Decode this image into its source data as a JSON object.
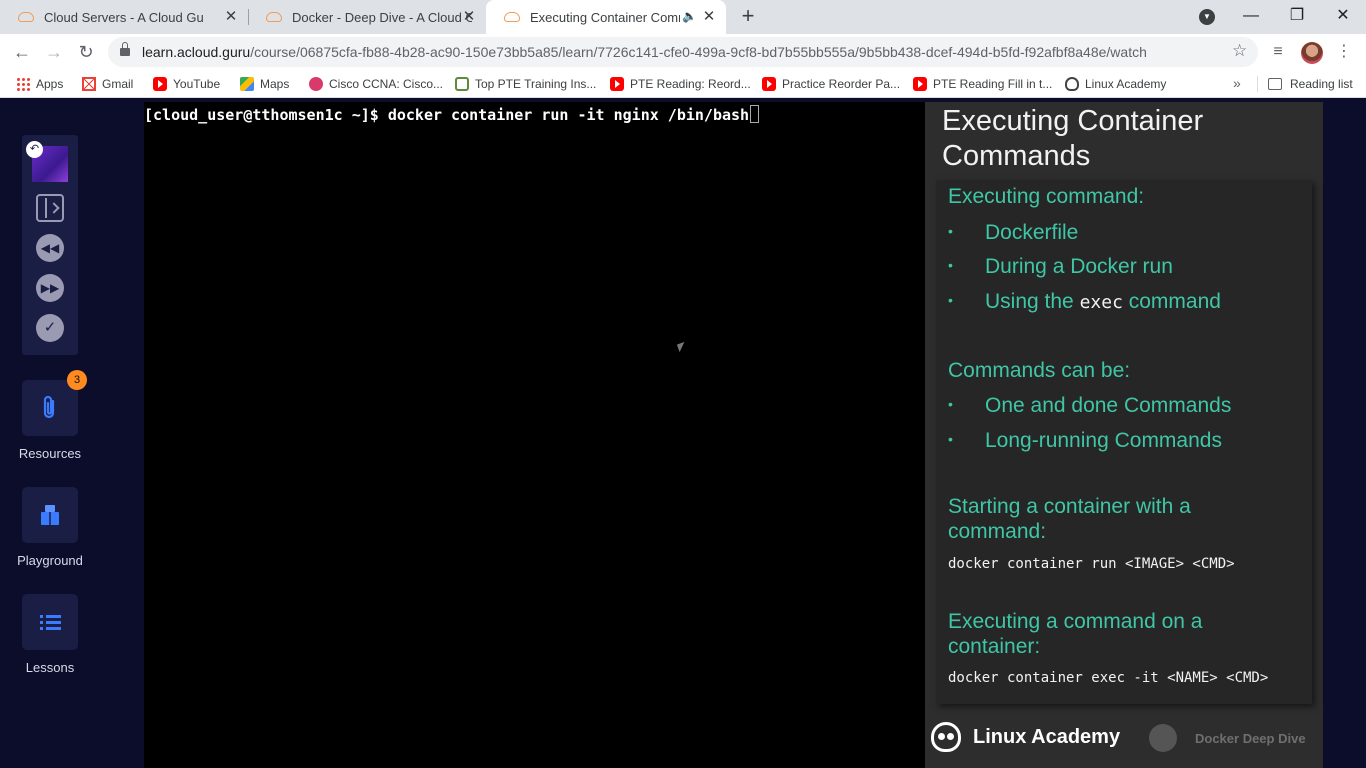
{
  "browser": {
    "tabs": [
      {
        "title": "Cloud Servers - A Cloud Guru",
        "active": false
      },
      {
        "title": "Docker - Deep Dive - A Cloud Gu",
        "active": false
      },
      {
        "title": "Executing Container Comma",
        "active": true
      }
    ],
    "new_tab": "+",
    "url_host": "learn.acloud.guru",
    "url_path": "/course/06875cfa-fb88-4b28-ac90-150e73bb5a85/learn/7726c141-cfe0-499a-9cf8-bd7b55bb555a/9b5bb438-dcef-494d-b5fd-f92afbf8a48e/watch",
    "bookmarks": [
      {
        "label": "Apps",
        "icon": "apps-grid-icon"
      },
      {
        "label": "Gmail",
        "icon": "gmail-icon"
      },
      {
        "label": "YouTube",
        "icon": "youtube-icon"
      },
      {
        "label": "Maps",
        "icon": "maps-icon"
      },
      {
        "label": "Cisco CCNA: Cisco...",
        "icon": "cisco-icon"
      },
      {
        "label": "Top PTE Training Ins...",
        "icon": "pte-icon"
      },
      {
        "label": "PTE Reading: Reord...",
        "icon": "youtube-icon"
      },
      {
        "label": "Practice Reorder Pa...",
        "icon": "youtube-icon"
      },
      {
        "label": "PTE Reading Fill in t...",
        "icon": "youtube-icon"
      },
      {
        "label": "Linux Academy",
        "icon": "linux-academy-icon"
      }
    ],
    "reading_list": "Reading list"
  },
  "sidebar": {
    "resources_label": "Resources",
    "resources_badge": "3",
    "playground_label": "Playground",
    "lessons_label": "Lessons"
  },
  "terminal": {
    "prompt": "[cloud_user@tthomsen1c ~]$ ",
    "command": "docker container run -it nginx /bin/bash"
  },
  "slide": {
    "title": "Executing Container Commands",
    "section1": "Executing command:",
    "bullet1": "Dockerfile",
    "bullet2": "During a Docker run",
    "bullet3_pre": "Using the ",
    "bullet3_code": "exec",
    "bullet3_post": " command",
    "section2": "Commands can be:",
    "bullet4": "One and done Commands",
    "bullet5": "Long-running Commands",
    "section3": "Starting a container with a command:",
    "code1": "docker container run <IMAGE> <CMD>",
    "section4": "Executing a command on a container:",
    "code2": "docker container exec -it <NAME> <CMD>",
    "brand": "Linux Academy",
    "course_brand": "Docker Deep Dive"
  }
}
